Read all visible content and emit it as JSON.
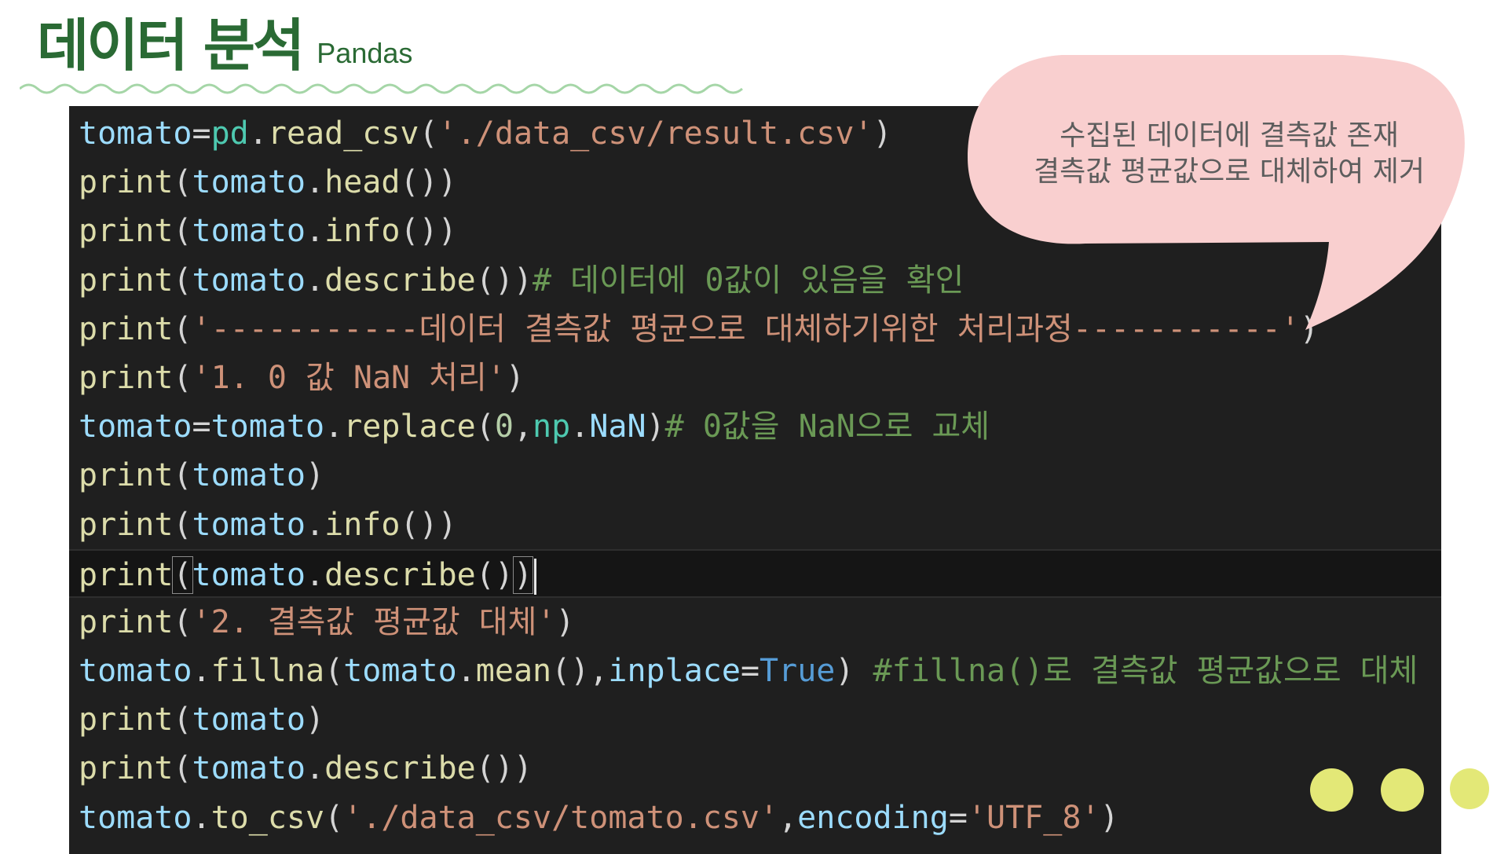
{
  "header": {
    "title": "데이터 분석",
    "subtitle": "Pandas"
  },
  "callout": {
    "lines": [
      "수집된 데이터에 결측값 존재",
      "결측값 평균값으로 대체하여 제거"
    ]
  },
  "code": {
    "l1": [
      "tomato",
      "=",
      "pd",
      ".",
      "read_csv",
      "(",
      "'./data_csv/result.csv'",
      ")"
    ],
    "l2": [
      "print",
      "(",
      "tomato",
      ".",
      "head",
      "())"
    ],
    "l3": [
      "print",
      "(",
      "tomato",
      ".",
      "info",
      "())"
    ],
    "l4": [
      "print",
      "(",
      "tomato",
      ".",
      "describe",
      "())",
      "# 데이터에 0값이 있음을 확인"
    ],
    "l5": [
      "print",
      "(",
      "'-----------데이터 결측값 평균으로 대체하기위한 처리과정-----------'",
      ")"
    ],
    "l6": [
      "print",
      "(",
      "'1. 0 값 NaN 처리'",
      ")"
    ],
    "l7": [
      "tomato",
      "=",
      "tomato",
      ".",
      "replace",
      "(",
      "0",
      ",",
      "np",
      ".",
      "NaN",
      ")",
      "# 0값을 NaN으로 교체"
    ],
    "l8": [
      "print",
      "(",
      "tomato",
      ")"
    ],
    "l9": [
      "print",
      "(",
      "tomato",
      ".",
      "info",
      "())"
    ],
    "l10": [
      "print",
      "(",
      "tomato",
      ".",
      "describe",
      "()",
      ")"
    ],
    "l11": [
      "print",
      "(",
      "'2. 결측값 평균값 대체'",
      ")"
    ],
    "l12": [
      "tomato",
      ".",
      "fillna",
      "(",
      "tomato",
      ".",
      "mean",
      "(),",
      "inplace",
      "=",
      "True",
      ") ",
      "#fillna()로 결측값 평균값으로 대체"
    ],
    "l13": [
      "print",
      "(",
      "tomato",
      ")"
    ],
    "l14": [
      "print",
      "(",
      "tomato",
      ".",
      "describe",
      "())"
    ],
    "l15": [
      "tomato",
      ".",
      "to_csv",
      "(",
      "'./data_csv/tomato.csv'",
      ",",
      "encoding",
      "=",
      "'UTF_8'",
      ")"
    ]
  },
  "colors": {
    "title_green": "#2a6a34",
    "wave_green": "#a5d6a7",
    "bubble_pink": "#f9cfcf",
    "dot_yellow": "#e3e877",
    "editor_bg": "#1f1f1f"
  }
}
